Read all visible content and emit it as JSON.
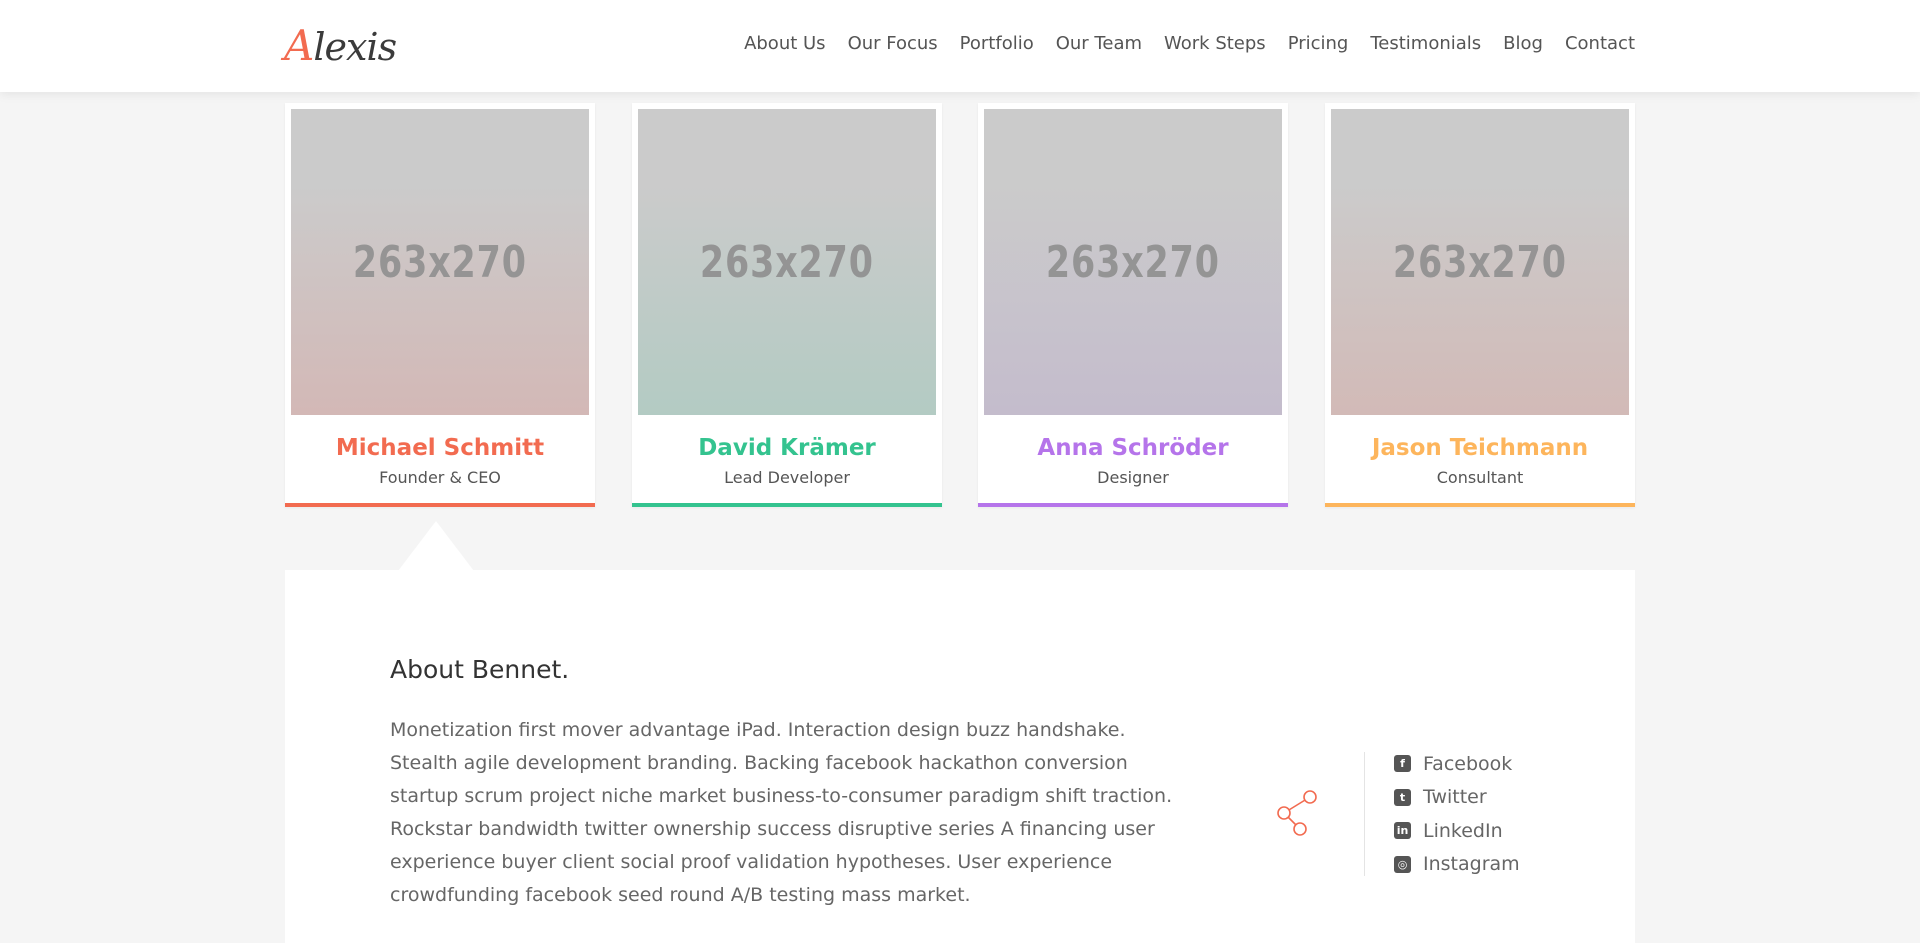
{
  "header": {
    "logo_initial": "A",
    "logo_rest": "lexis",
    "nav": [
      "About Us",
      "Our Focus",
      "Portfolio",
      "Our Team",
      "Work Steps",
      "Pricing",
      "Testimonials",
      "Blog",
      "Contact"
    ]
  },
  "team": [
    {
      "name": "Michael Schmitt",
      "role": "Founder & CEO",
      "image_label": "263x270",
      "color": "#f26b50",
      "tint": "#d3b8b6"
    },
    {
      "name": "David Krämer",
      "role": "Lead Developer",
      "image_label": "263x270",
      "color": "#34c38f",
      "tint": "#b3cbc3"
    },
    {
      "name": "Anna Schröder",
      "role": "Designer",
      "image_label": "263x270",
      "color": "#b574ea",
      "tint": "#c4bccc"
    },
    {
      "name": "Jason Teichmann",
      "role": "Consultant",
      "image_label": "263x270",
      "color": "#fdb55c",
      "tint": "#d2bab7"
    }
  ],
  "about": {
    "title": "About Bennet.",
    "text": "Monetization first mover advantage iPad. Interaction design buzz handshake. Stealth agile development branding. Backing facebook hackathon conversion startup scrum project niche market business-to-consumer paradigm shift traction. Rockstar bandwidth twitter ownership success disruptive series A financing user experience buyer client social proof validation hypotheses. User experience crowdfunding facebook seed round A/B testing mass market."
  },
  "social": [
    {
      "label": "Facebook",
      "icon": "facebook-icon",
      "glyph": "f"
    },
    {
      "label": "Twitter",
      "icon": "twitter-icon",
      "glyph": "t"
    },
    {
      "label": "LinkedIn",
      "icon": "linkedin-icon",
      "glyph": "in"
    },
    {
      "label": "Instagram",
      "icon": "instagram-icon",
      "glyph": "◎"
    }
  ],
  "colors": {
    "accent": "#f26b50",
    "background": "#f5f5f5"
  }
}
